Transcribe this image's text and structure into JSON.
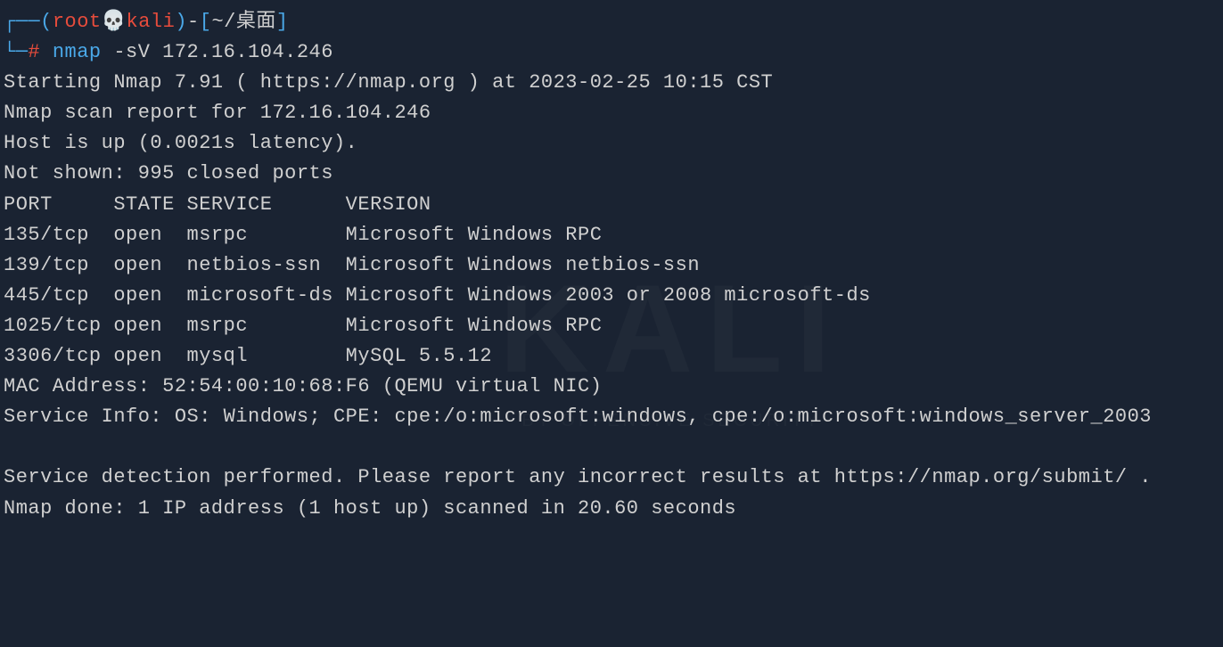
{
  "prompt": {
    "branch_top": "┌──",
    "paren_open": "(",
    "user": "root",
    "skull": "💀",
    "host": "kali",
    "paren_close": ")",
    "dash": "-",
    "bracket_open": "[",
    "path": "~/桌面",
    "bracket_close": "]",
    "branch_bottom": "└─",
    "hash": "#",
    "command_name": "nmap",
    "command_args": " -sV 172.16.104.246"
  },
  "output": {
    "line1": "Starting Nmap 7.91 ( https://nmap.org ) at 2023-02-25 10:15 CST",
    "line2": "Nmap scan report for 172.16.104.246",
    "line3": "Host is up (0.0021s latency).",
    "line4": "Not shown: 995 closed ports",
    "header": "PORT     STATE SERVICE      VERSION",
    "rows": [
      "135/tcp  open  msrpc        Microsoft Windows RPC",
      "139/tcp  open  netbios-ssn  Microsoft Windows netbios-ssn",
      "445/tcp  open  microsoft-ds Microsoft Windows 2003 or 2008 microsoft-ds",
      "1025/tcp open  msrpc        Microsoft Windows RPC",
      "3306/tcp open  mysql        MySQL 5.5.12"
    ],
    "mac": "MAC Address: 52:54:00:10:68:F6 (QEMU virtual NIC)",
    "service_info": "Service Info: OS: Windows; CPE: cpe:/o:microsoft:windows, cpe:/o:microsoft:windows_server_2003",
    "blank": " ",
    "detection": "Service detection performed. Please report any incorrect results at https://nmap.org/submit/ .",
    "done": "Nmap done: 1 IP address (1 host up) scanned in 20.60 seconds"
  },
  "watermark": {
    "title": "KALI",
    "subtitle": "BY OFFENSIVE SECURITY"
  }
}
